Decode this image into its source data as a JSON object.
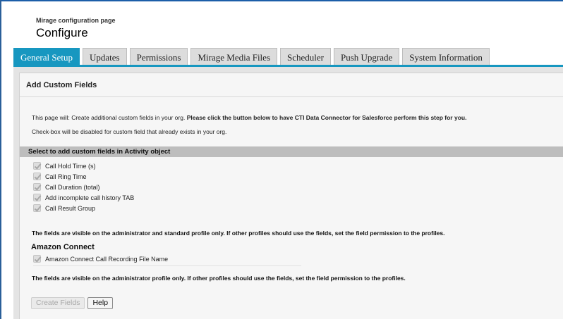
{
  "header": {
    "subtitle": "Mirage configuration page",
    "title": "Configure"
  },
  "tabs": [
    {
      "label": "General Setup",
      "active": true
    },
    {
      "label": "Updates"
    },
    {
      "label": "Permissions"
    },
    {
      "label": "Mirage Media Files"
    },
    {
      "label": "Scheduler"
    },
    {
      "label": "Push Upgrade"
    },
    {
      "label": "System Information"
    }
  ],
  "section": {
    "title": "Add Custom Fields",
    "intro_plain": "This page will: Create additional custom fields in your org. ",
    "intro_bold": "Please click the button below to have CTI Data Connector for Salesforce perform this step for you.",
    "checkbox_note": "Check-box will be disabled for custom field that already exists in your org."
  },
  "activity": {
    "heading": "Select to add custom fields in Activity object",
    "fields": [
      {
        "label": "Call Hold Time (s)",
        "checked": true,
        "disabled": true
      },
      {
        "label": "Call Ring Time",
        "checked": true,
        "disabled": true
      },
      {
        "label": "Call Duration (total)",
        "checked": true,
        "disabled": true
      },
      {
        "label": "Add incomplete call history TAB",
        "checked": true,
        "disabled": true
      },
      {
        "label": "Call Result Group",
        "checked": true,
        "disabled": true
      }
    ],
    "note": "The fields are visible on the administrator and standard profile only. If other profiles should use the fields, set the field permission to the profiles."
  },
  "amazon": {
    "heading": "Amazon Connect",
    "fields": [
      {
        "label": "Amazon Connect Call Recording File Name",
        "checked": true,
        "disabled": true
      }
    ],
    "note": "The fields are visible on the administrator profile only. If other profiles should use the fields, set the field permission to the profiles."
  },
  "buttons": {
    "create_label": "Create Fields",
    "help_label": "Help"
  },
  "colors": {
    "active_tab": "#1797c0",
    "subbar": "#bdbdbd"
  }
}
